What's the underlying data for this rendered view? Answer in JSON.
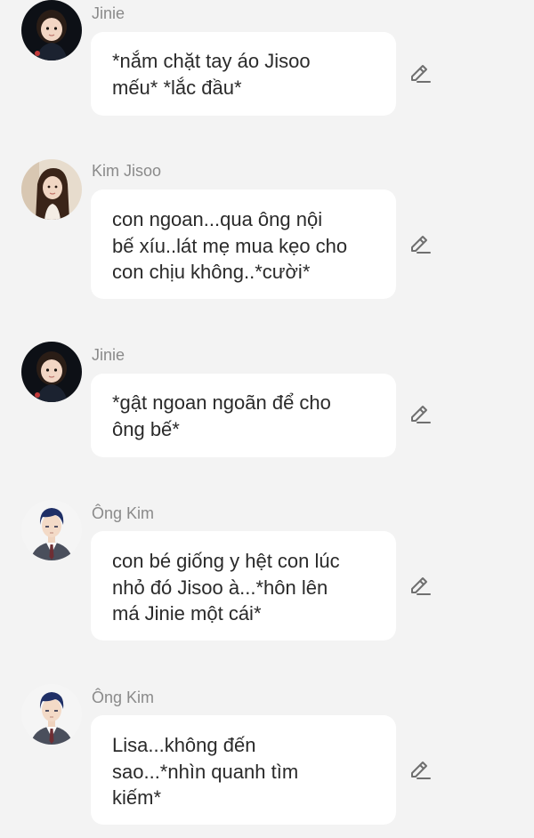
{
  "messages": [
    {
      "sender": "Jinie",
      "avatar_icon": "girl-avatar-icon",
      "text": "*nắm chặt tay áo Jisoo\nmếu* *lắc đầu*"
    },
    {
      "sender": "Kim Jisoo",
      "avatar_icon": "woman-avatar-icon",
      "text": "con ngoan...qua ông nội\nbế xíu..lát mẹ mua kẹo cho\ncon chịu không..*cười*"
    },
    {
      "sender": "Jinie",
      "avatar_icon": "girl-avatar-icon",
      "text": "*gật ngoan ngoãn để cho\nông bế*"
    },
    {
      "sender": "Ông Kim",
      "avatar_icon": "man-avatar-icon",
      "text": "con bé giống y hệt con lúc\nnhỏ đó Jisoo à...*hôn lên\nmá Jinie một cái*"
    },
    {
      "sender": "Ông Kim",
      "avatar_icon": "man-avatar-icon",
      "text": "Lisa...không đến\nsao...*nhìn quanh tìm\nkiếm*"
    }
  ],
  "colors": {
    "background": "#f3f3f3",
    "bubble": "#ffffff",
    "sender_name": "#8a8a8a",
    "message_text": "#2a2a2a",
    "edit_icon": "#6f6f6f"
  }
}
